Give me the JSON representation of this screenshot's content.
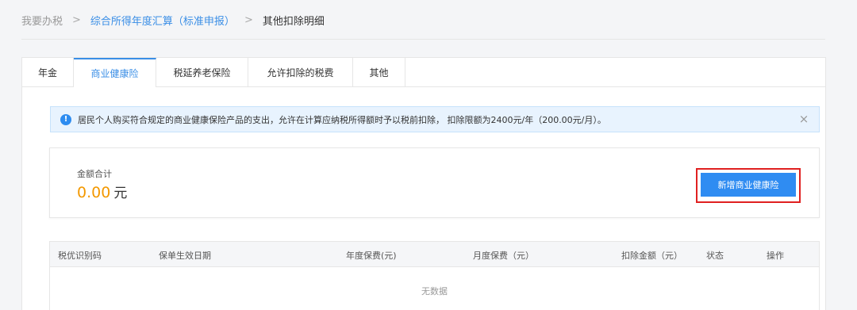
{
  "breadcrumb": {
    "home": "我要办税",
    "parent": "综合所得年度汇算（标准申报）",
    "current": "其他扣除明细",
    "separator": ">"
  },
  "tabs": [
    {
      "label": "年金",
      "active": false
    },
    {
      "label": "商业健康险",
      "active": true
    },
    {
      "label": "税延养老保险",
      "active": false
    },
    {
      "label": "允许扣除的税费",
      "active": false
    },
    {
      "label": "其他",
      "active": false
    }
  ],
  "notice": {
    "icon": "info-icon",
    "text": "居民个人购买符合规定的商业健康保险产品的支出，允许在计算应纳税所得额时予以税前扣除， 扣除限额为2400元/年（200.00元/月）。",
    "close": "×"
  },
  "summary": {
    "label": "金额合计",
    "value": "0.00",
    "unit": "元"
  },
  "add_button": {
    "label": "新增商业健康险"
  },
  "table": {
    "columns": [
      "税优识别码",
      "保单生效日期",
      "年度保费(元)",
      "月度保费（元）",
      "扣除金额（元）",
      "状态",
      "操作"
    ],
    "empty_text": "无数据"
  },
  "colors": {
    "accent": "#3a8ee6",
    "button": "#2f8cf2",
    "amount": "#f39800",
    "highlight": "#e02020",
    "notice_bg": "#e8f3fe"
  }
}
